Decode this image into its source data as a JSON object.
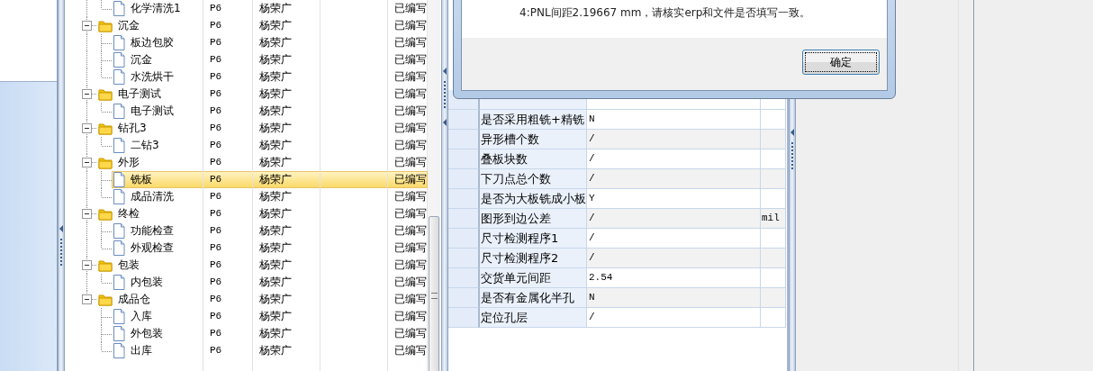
{
  "tree": {
    "groups": [
      {
        "children": [
          {
            "name": "化学清洗1",
            "col_2": "P6",
            "col_3": "杨荣广",
            "col_5": "已编写",
            "selected": false
          }
        ]
      },
      {
        "name": "沉金",
        "col_2": "P6",
        "col_3": "杨荣广",
        "col_5": "已编写",
        "expanded": true,
        "selected": false,
        "children": [
          {
            "name": "板边包胶",
            "col_2": "P6",
            "col_3": "杨荣广",
            "col_5": "已编写",
            "selected": false
          },
          {
            "name": "沉金",
            "col_2": "P6",
            "col_3": "杨荣广",
            "col_5": "已编写",
            "selected": false
          },
          {
            "name": "水洗烘干",
            "col_2": "P6",
            "col_3": "杨荣广",
            "col_5": "已编写",
            "selected": false
          }
        ]
      },
      {
        "name": "电子测试",
        "col_2": "P6",
        "col_3": "杨荣广",
        "col_5": "已编写",
        "expanded": true,
        "selected": false,
        "children": [
          {
            "name": "电子测试",
            "col_2": "P6",
            "col_3": "杨荣广",
            "col_5": "已编写",
            "selected": false
          }
        ]
      },
      {
        "name": "钻孔3",
        "col_2": "P6",
        "col_3": "杨荣广",
        "col_5": "已编写",
        "expanded": true,
        "selected": false,
        "children": [
          {
            "name": "二钻3",
            "col_2": "P6",
            "col_3": "杨荣广",
            "col_5": "已编写",
            "selected": false
          }
        ]
      },
      {
        "name": "外形",
        "col_2": "P6",
        "col_3": "杨荣广",
        "col_5": "已编写",
        "expanded": true,
        "selected": false,
        "children": [
          {
            "name": "铣板",
            "col_2": "P6",
            "col_3": "杨荣广",
            "col_5": "已编写",
            "selected": true
          },
          {
            "name": "成品清洗",
            "col_2": "P6",
            "col_3": "杨荣广",
            "col_5": "已编写",
            "selected": false
          }
        ]
      },
      {
        "name": "终检",
        "col_2": "P6",
        "col_3": "杨荣广",
        "col_5": "已编写",
        "expanded": true,
        "selected": false,
        "children": [
          {
            "name": "功能检查",
            "col_2": "P6",
            "col_3": "杨荣广",
            "col_5": "已编写",
            "selected": false
          },
          {
            "name": "外观检查",
            "col_2": "P6",
            "col_3": "杨荣广",
            "col_5": "已编写",
            "selected": false
          }
        ]
      },
      {
        "name": "包装",
        "col_2": "P6",
        "col_3": "杨荣广",
        "col_5": "已编写",
        "expanded": true,
        "selected": false,
        "children": [
          {
            "name": "内包装",
            "col_2": "P6",
            "col_3": "杨荣广",
            "col_5": "已编写",
            "selected": false
          }
        ]
      },
      {
        "name": "成品仓",
        "col_2": "P6",
        "col_3": "杨荣广",
        "col_5": "已编写",
        "expanded": true,
        "selected": false,
        "children": [
          {
            "name": "入库",
            "col_2": "P6",
            "col_3": "杨荣广",
            "col_5": "已编写",
            "selected": false
          },
          {
            "name": "外包装",
            "col_2": "P6",
            "col_3": "杨荣广",
            "col_5": "已编写",
            "selected": false
          },
          {
            "name": "出库",
            "col_2": "P6",
            "col_3": "杨荣广",
            "col_5": "已编写",
            "selected": false
          }
        ]
      }
    ]
  },
  "property_grid": {
    "rows": [
      {
        "name": "是否采用粗铣+精铣",
        "value": "N"
      },
      {
        "name": "异形槽个数",
        "value": "/"
      },
      {
        "name": "叠板块数",
        "value": "/"
      },
      {
        "name": "下刀点总个数",
        "value": "/"
      },
      {
        "name": "是否为大板铣成小板",
        "value": "Y"
      },
      {
        "name": "图形到边公差",
        "value": "/",
        "unit": "mil"
      },
      {
        "name": "尺寸检测程序1",
        "value": "/"
      },
      {
        "name": "尺寸检测程序2",
        "value": "/"
      },
      {
        "name": "交货单元间距",
        "value": "2.54"
      },
      {
        "name": "是否有金属化半孔",
        "value": "N"
      },
      {
        "name": "定位孔层",
        "value": "/"
      }
    ]
  },
  "dialog": {
    "message": "4:PNL间距2.19667 mm，请核实erp和文件是否填写一致。",
    "buttons": [
      "确定"
    ]
  }
}
